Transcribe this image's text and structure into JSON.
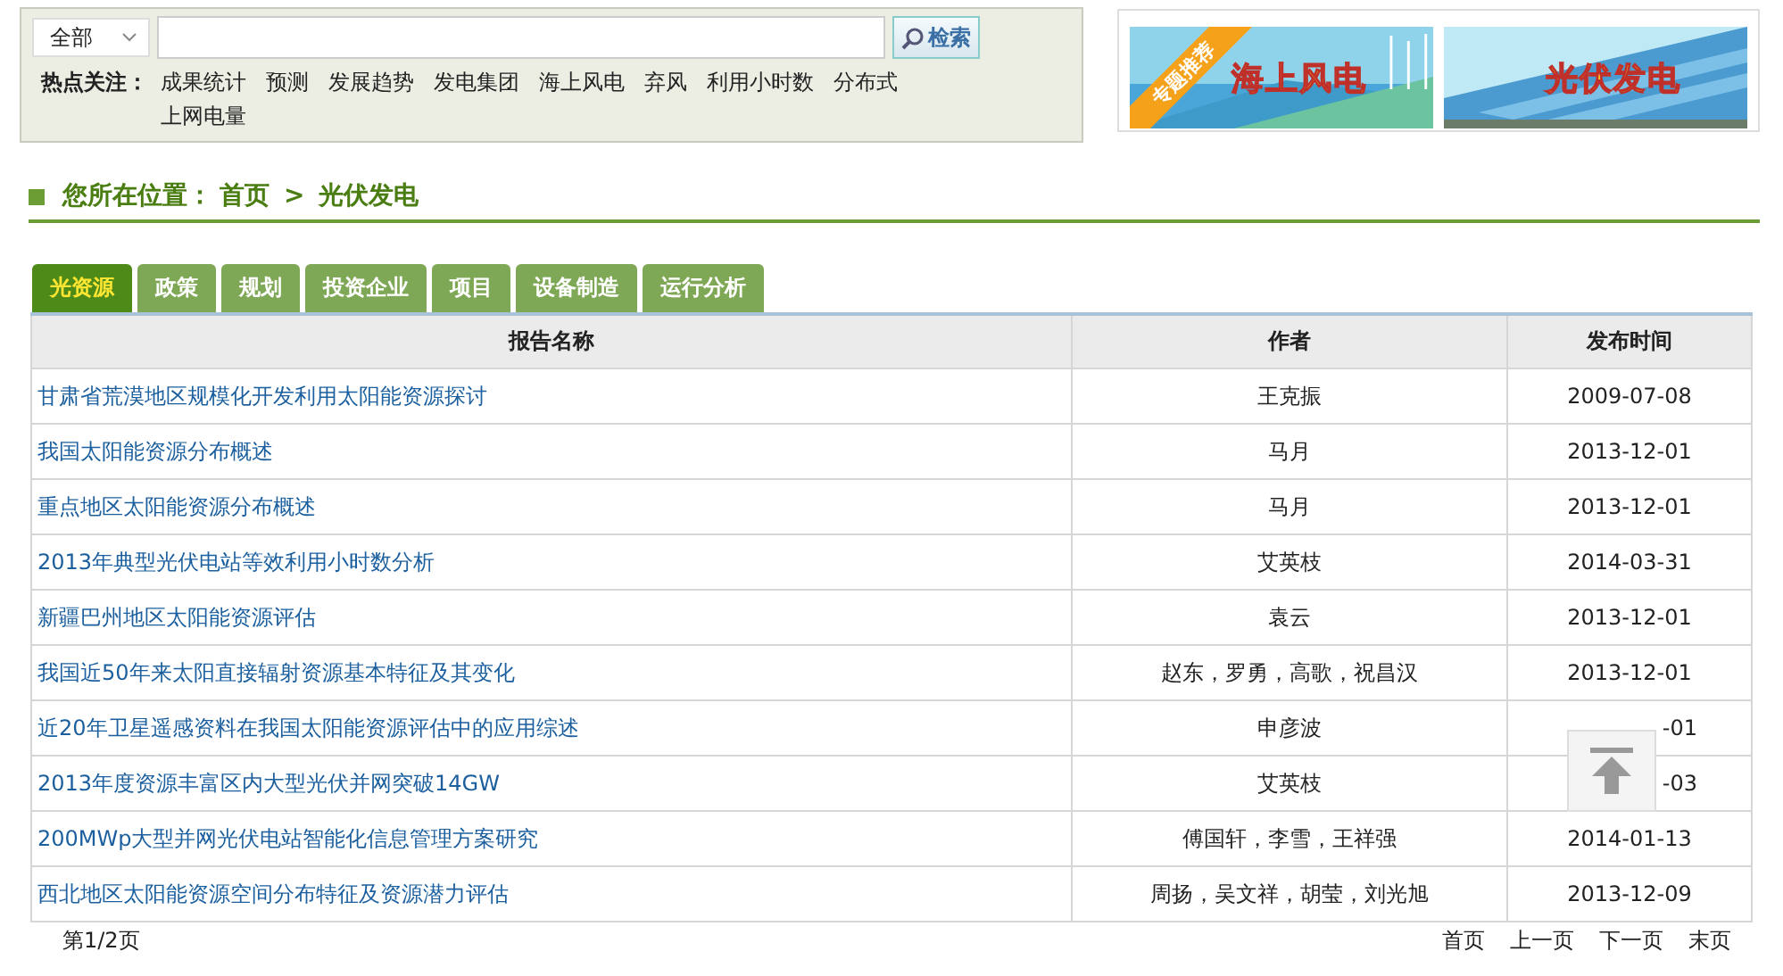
{
  "search": {
    "scope": "全部",
    "button": "检索"
  },
  "hot_topics": {
    "label": "热点关注：",
    "items": [
      "成果统计",
      "预测",
      "发展趋势",
      "发电集团",
      "海上风电",
      "弃风",
      "利用小时数",
      "分布式",
      "上网电量"
    ]
  },
  "banner": {
    "ribbon": "专题推荐",
    "items": [
      {
        "kind": "wind",
        "title": "海上风电"
      },
      {
        "kind": "solar",
        "title": "光伏发电"
      }
    ]
  },
  "breadcrumb": {
    "label": "您所在位置：",
    "items": [
      "首页",
      "光伏发电"
    ],
    "separator": ">"
  },
  "tabs": [
    {
      "label": "光资源",
      "selected": true
    },
    {
      "label": "政策",
      "selected": false
    },
    {
      "label": "规划",
      "selected": false
    },
    {
      "label": "投资企业",
      "selected": false
    },
    {
      "label": "项目",
      "selected": false
    },
    {
      "label": "设备制造",
      "selected": false
    },
    {
      "label": "运行分析",
      "selected": false
    }
  ],
  "table": {
    "columns": [
      "报告名称",
      "作者",
      "发布时间"
    ],
    "rows": [
      {
        "title": "甘肃省荒漠地区规模化开发利用太阳能资源探讨",
        "author": "王克振",
        "date": "2009-07-08",
        "covered": false
      },
      {
        "title": "我国太阳能资源分布概述",
        "author": "马月",
        "date": "2013-12-01",
        "covered": false
      },
      {
        "title": "重点地区太阳能资源分布概述",
        "author": "马月",
        "date": "2013-12-01",
        "covered": false
      },
      {
        "title": "2013年典型光伏电站等效利用小时数分析",
        "author": "艾英枝",
        "date": "2014-03-31",
        "covered": false
      },
      {
        "title": "新疆巴州地区太阳能资源评估",
        "author": "袁云",
        "date": "2013-12-01",
        "covered": false
      },
      {
        "title": "我国近50年来太阳直接辐射资源基本特征及其变化",
        "author": "赵东，罗勇，高歌，祝昌汉",
        "date": "2013-12-01",
        "covered": false
      },
      {
        "title": "近20年卫星遥感资料在我国太阳能资源评估中的应用综述",
        "author": "申彦波",
        "date": "-01",
        "covered": true
      },
      {
        "title": "2013年度资源丰富区内大型光伏并网突破14GW",
        "author": "艾英枝",
        "date": "-03",
        "covered": true
      },
      {
        "title": "200MWp大型并网光伏电站智能化信息管理方案研究",
        "author": "傅国轩，李雪，王祥强",
        "date": "2014-01-13",
        "covered": false
      },
      {
        "title": "西北地区太阳能资源空间分布特征及资源潜力评估",
        "author": "周扬，吴文祥，胡莹，刘光旭",
        "date": "2013-12-09",
        "covered": false
      }
    ]
  },
  "pagination": {
    "status": "第1/2页",
    "links": [
      "首页",
      "上一页",
      "下一页",
      "末页"
    ]
  }
}
